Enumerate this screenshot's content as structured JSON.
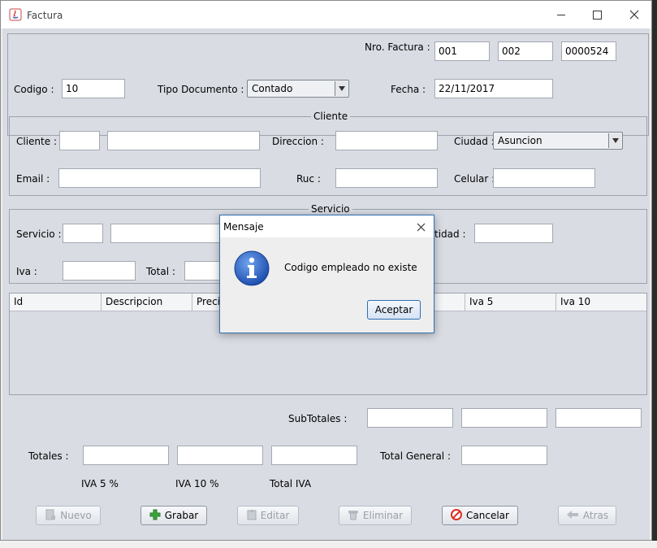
{
  "window": {
    "title": "Factura"
  },
  "header": {
    "nro_factura_label": "Nro. Factura :",
    "nro_factura": [
      "001",
      "002",
      "0000524"
    ],
    "codigo_label": "Codigo :",
    "codigo_value": "10",
    "tipo_documento_label": "Tipo Documento :",
    "tipo_documento_value": "Contado",
    "fecha_label": "Fecha :",
    "fecha_value": "22/11/2017"
  },
  "cliente": {
    "legend": "Cliente",
    "cliente_label": "Cliente :",
    "direccion_label": "Direccion :",
    "ciudad_label": "Ciudad :",
    "ciudad_value": "Asuncion",
    "email_label": "Email :",
    "ruc_label": "Ruc :",
    "celular_label": "Celular :"
  },
  "servicio": {
    "legend": "Servicio",
    "servicio_label": "Servicio :",
    "cantidad_label": "tidad :",
    "iva_label": "Iva :",
    "total_label": "Total :"
  },
  "table": {
    "columns": [
      "Id",
      "Descripcion",
      "Precio",
      "",
      "",
      "Iva 5",
      "Iva 10"
    ]
  },
  "totals": {
    "subtotales_label": "SubTotales :",
    "totales_label": "Totales :",
    "total_general_label": "Total General :",
    "iva5_caption": "IVA 5 %",
    "iva10_caption": "IVA 10 %",
    "total_iva_caption": "Total IVA"
  },
  "buttons": {
    "nuevo": "Nuevo",
    "grabar": "Grabar",
    "editar": "Editar",
    "eliminar": "Eliminar",
    "cancelar": "Cancelar",
    "atras": "Atras"
  },
  "dialog": {
    "title": "Mensaje",
    "message": "Codigo empleado no existe",
    "ok_label": "Aceptar"
  },
  "colors": {
    "panel_bg": "#d9dce3",
    "info_icon": "#2b63c8",
    "grabar_icon": "#3aa63a",
    "cancelar_icon": "#d93025"
  }
}
